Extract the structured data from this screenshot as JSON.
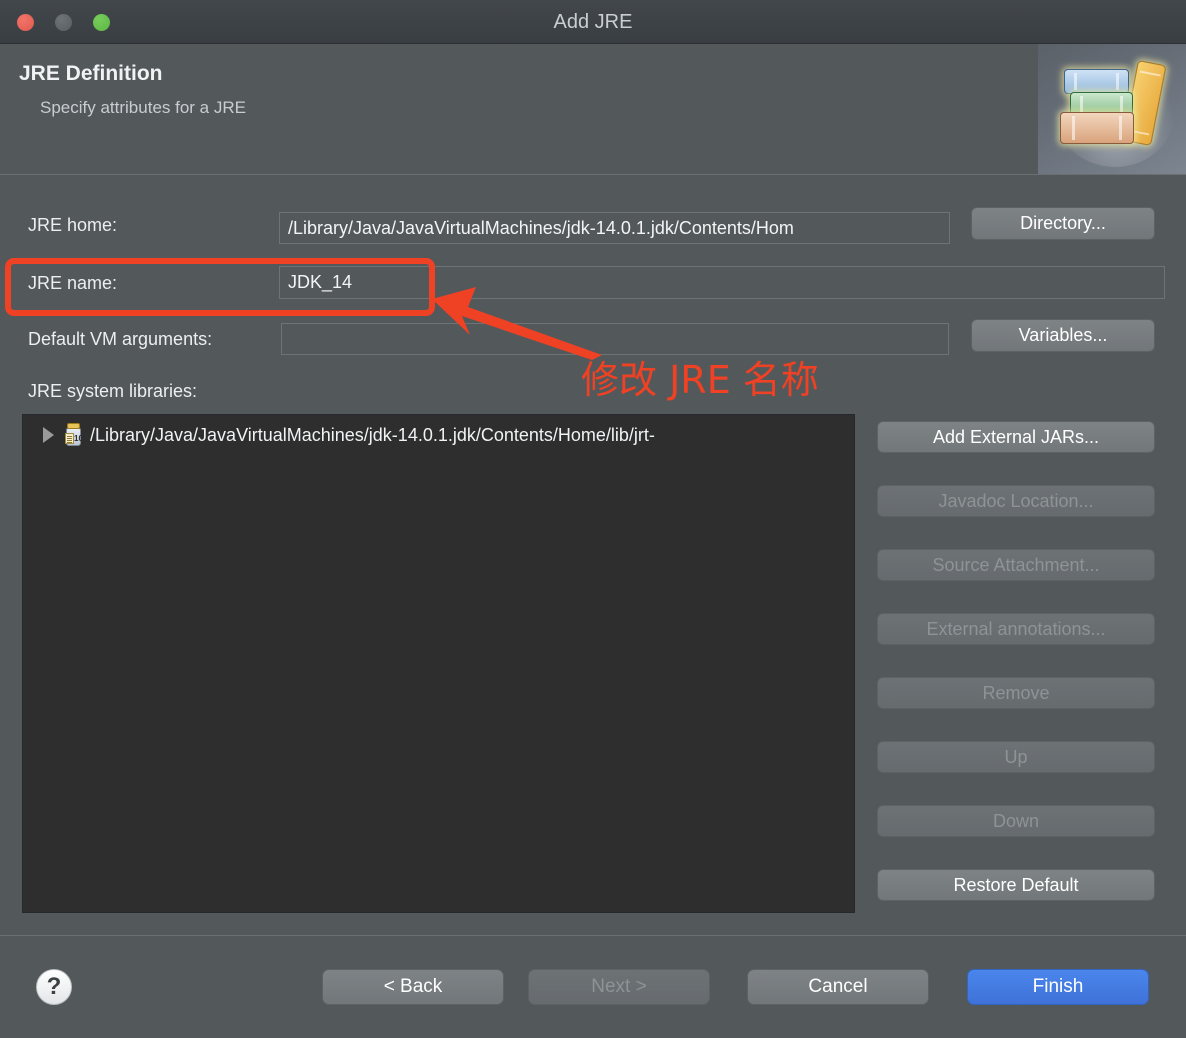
{
  "window": {
    "title": "Add JRE",
    "traffic_lights": {
      "close": "close-button",
      "minimize": "minimize-button",
      "maximize": "maximize-button"
    },
    "colors": {
      "background": "#53585b",
      "titlebar": "#3d4246",
      "tree_panel": "#2e2e2e",
      "primary_button": "#4a86ec",
      "annotation": "#ef4123",
      "close": "#ec6a5e",
      "minimize": "#606468",
      "maximize": "#62c555"
    }
  },
  "header": {
    "title": "JRE Definition",
    "subtitle": "Specify attributes for a JRE",
    "graphic": "books-stack-icon"
  },
  "form": {
    "jre_home": {
      "label": "JRE home:",
      "value": "/Library/Java/JavaVirtualMachines/jdk-14.0.1.jdk/Contents/Hom",
      "placeholder": "",
      "button": "Directory..."
    },
    "jre_name": {
      "label": "JRE name:",
      "value": "JDK_14",
      "placeholder": ""
    },
    "vm_arguments": {
      "label": "Default VM arguments:",
      "value": "",
      "placeholder": "",
      "button": "Variables..."
    },
    "system_libraries": {
      "label": "JRE system libraries:",
      "tree_items": [
        {
          "icon": "jar-icon",
          "label": "/Library/Java/JavaVirtualMachines/jdk-14.0.1.jdk/Contents/Home/lib/jrt-",
          "expanded": false
        }
      ]
    }
  },
  "side_buttons": [
    {
      "label": "Add External JARs...",
      "enabled": true
    },
    {
      "label": "Javadoc Location...",
      "enabled": false
    },
    {
      "label": "Source Attachment...",
      "enabled": false
    },
    {
      "label": "External annotations...",
      "enabled": false
    },
    {
      "label": "Remove",
      "enabled": false
    },
    {
      "label": "Up",
      "enabled": false
    },
    {
      "label": "Down",
      "enabled": false
    },
    {
      "label": "Restore Default",
      "enabled": true
    }
  ],
  "footer": {
    "help": "?",
    "back": "< Back",
    "next": "Next >",
    "cancel": "Cancel",
    "finish": "Finish"
  },
  "annotation": {
    "text": "修改 JRE 名称",
    "color": "#ef4123"
  }
}
